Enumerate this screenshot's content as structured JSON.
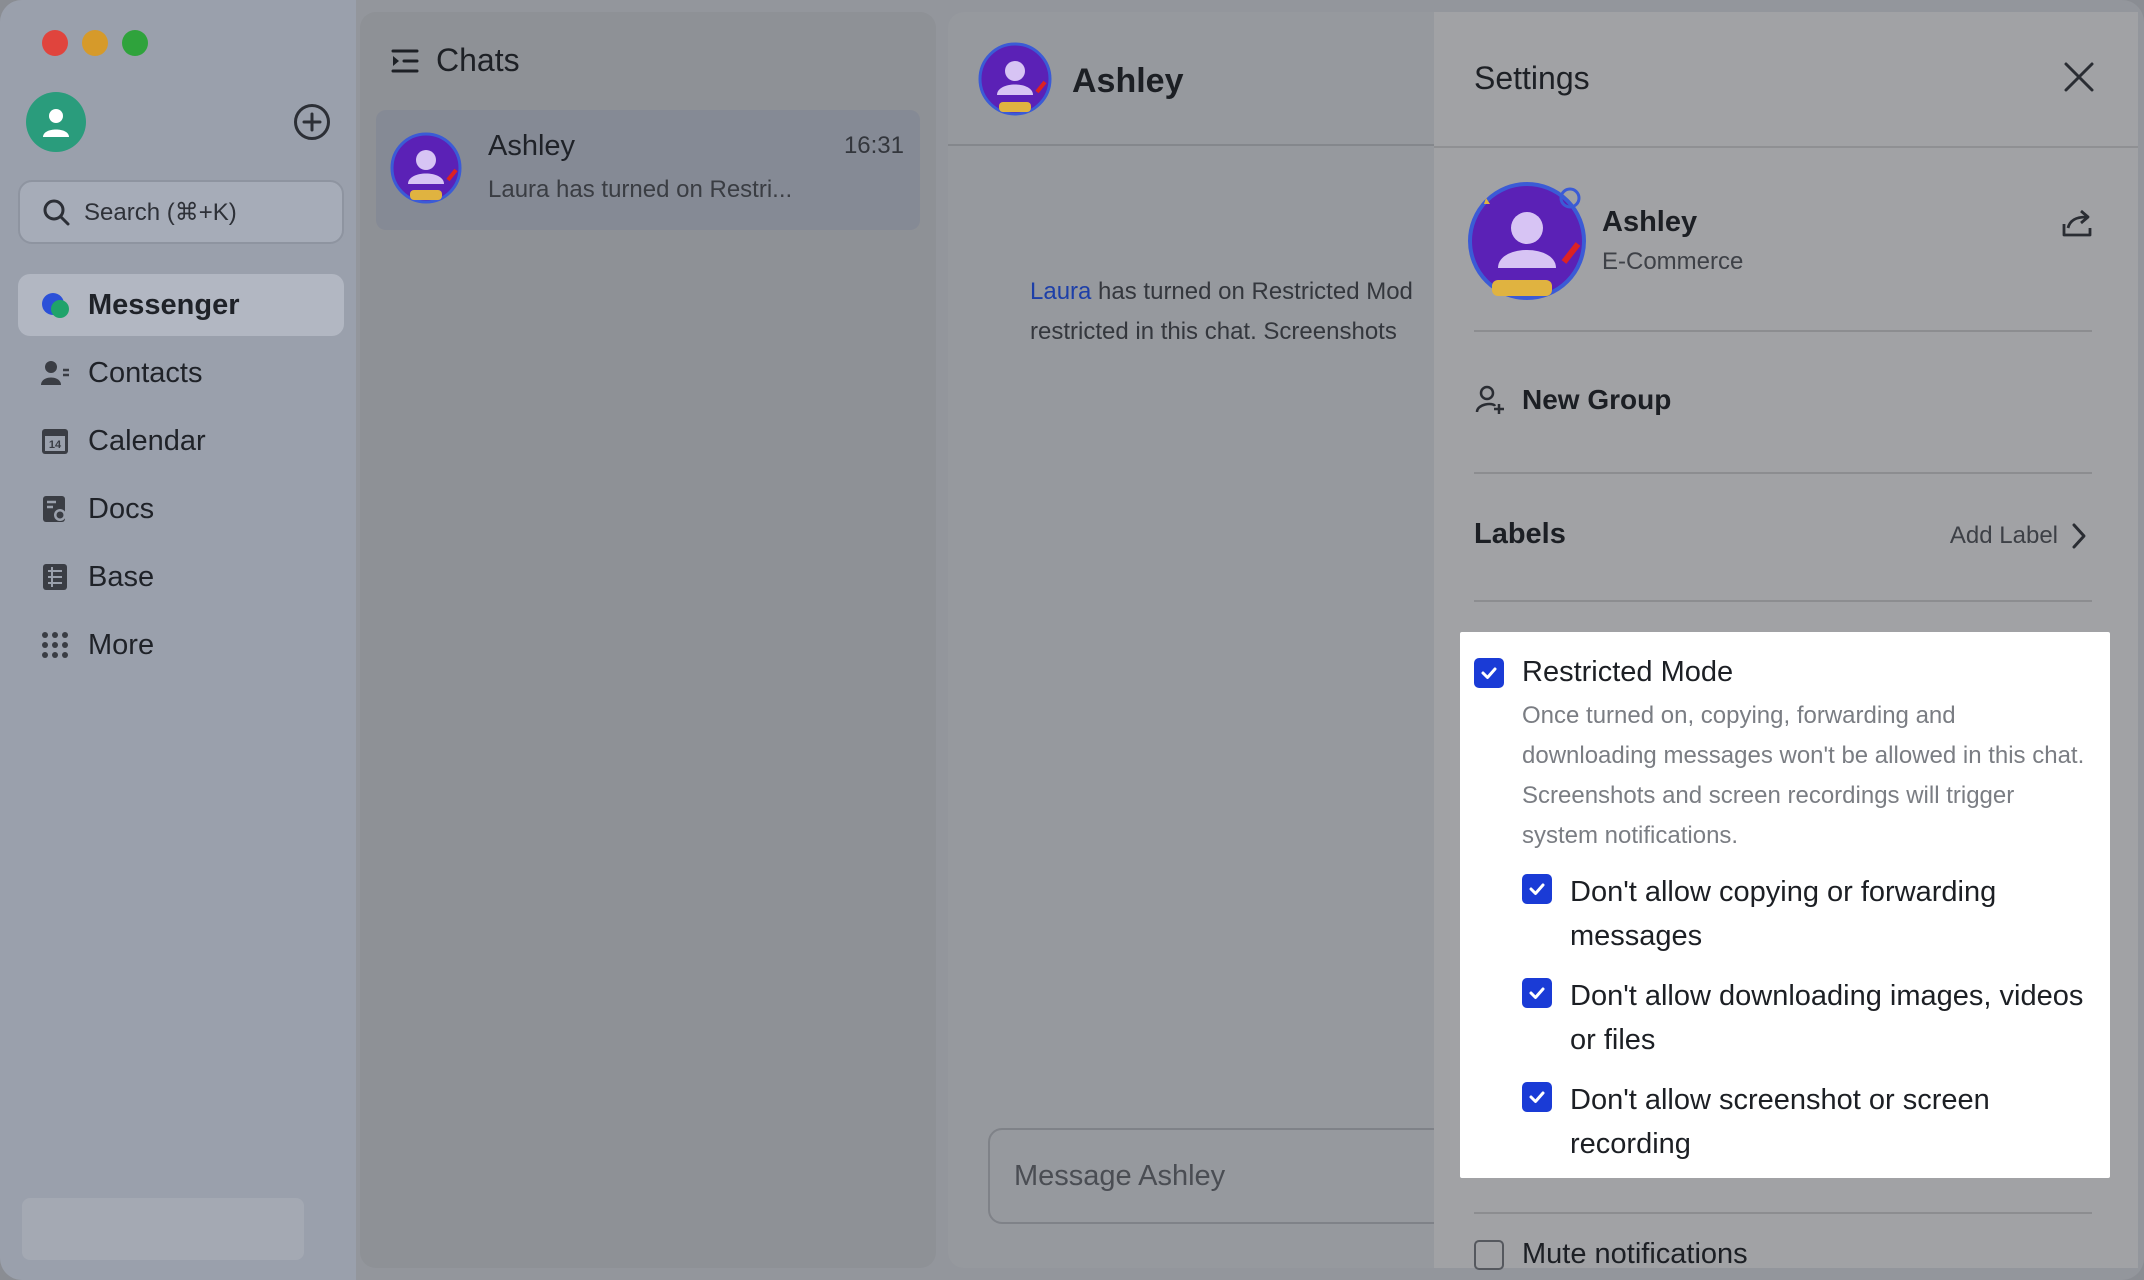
{
  "sidebar": {
    "search_placeholder": "Search (⌘+K)",
    "items": [
      {
        "label": "Messenger",
        "icon": "messenger-icon",
        "active": true
      },
      {
        "label": "Contacts",
        "icon": "contacts-icon"
      },
      {
        "label": "Calendar",
        "icon": "calendar-icon"
      },
      {
        "label": "Docs",
        "icon": "docs-icon"
      },
      {
        "label": "Base",
        "icon": "base-icon"
      },
      {
        "label": "More",
        "icon": "more-icon"
      }
    ],
    "calendar_day": "14"
  },
  "chats": {
    "title": "Chats",
    "items": [
      {
        "name": "Ashley",
        "time": "16:31",
        "preview": "Laura has turned on Restri..."
      }
    ]
  },
  "conversation": {
    "name": "Ashley",
    "system_message": {
      "actor": "Laura",
      "line1": " has turned on Restricted Mod",
      "line2": "restricted in this chat. Screenshots"
    },
    "input_placeholder": "Message Ashley"
  },
  "settings": {
    "title": "Settings",
    "profile": {
      "name": "Ashley",
      "subtitle": "E-Commerce"
    },
    "new_group": "New Group",
    "labels_title": "Labels",
    "add_label": "Add Label",
    "restricted_mode": {
      "title": "Restricted Mode",
      "checked": true,
      "description": "Once turned on, copying, forwarding and downloading messages won't be allowed in this chat. Screenshots and screen recordings will trigger system notifications.",
      "options": [
        {
          "label": "Don't allow copying or forwarding messages",
          "checked": true
        },
        {
          "label": "Don't allow downloading images, videos or files",
          "checked": true
        },
        {
          "label": "Don't allow screenshot or screen recording",
          "checked": true
        }
      ]
    },
    "mute_notifications": {
      "label": "Mute notifications",
      "checked": false
    }
  },
  "colors": {
    "accent": "#1a3bd6",
    "avatar_purple": "#5b21b6",
    "me_avatar": "#2a9c7c"
  }
}
